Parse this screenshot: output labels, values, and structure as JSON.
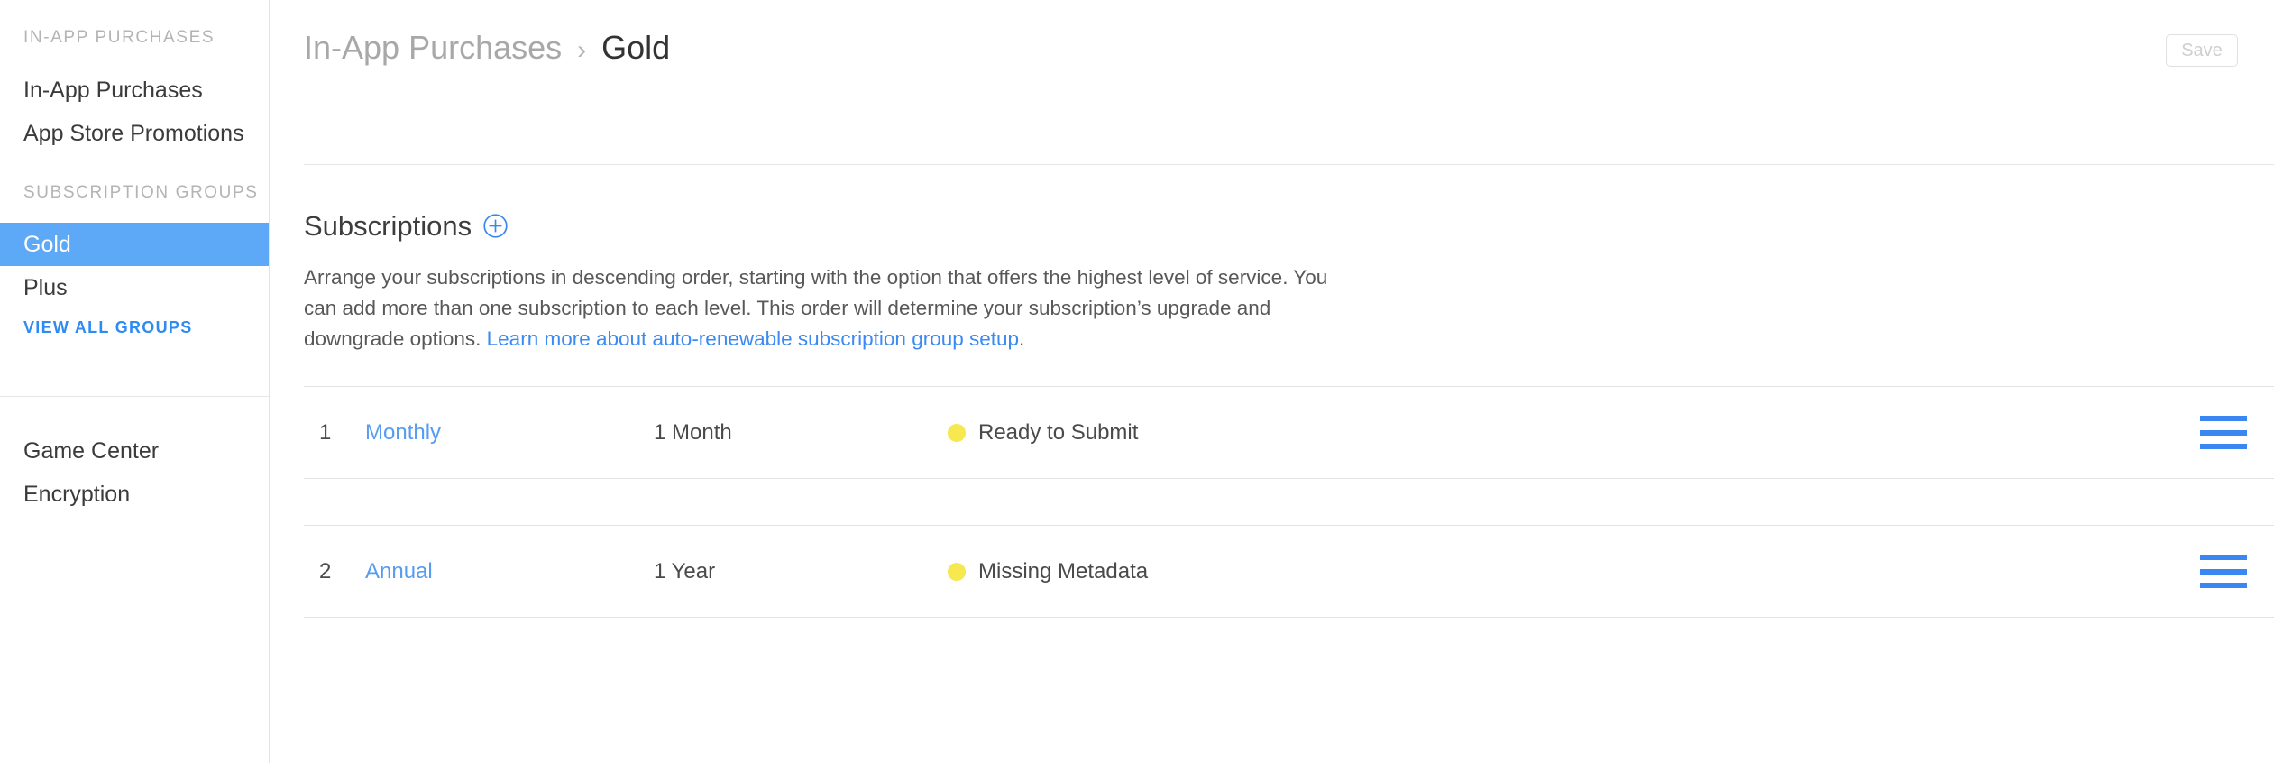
{
  "sidebar": {
    "sections": [
      {
        "header": "IN-APP PURCHASES",
        "items": [
          {
            "label": "In-App Purchases",
            "selected": false
          },
          {
            "label": "App Store Promotions",
            "selected": false
          }
        ]
      },
      {
        "header": "SUBSCRIPTION GROUPS",
        "items": [
          {
            "label": "Gold",
            "selected": true
          },
          {
            "label": "Plus",
            "selected": false
          }
        ],
        "link": "VIEW ALL GROUPS"
      },
      {
        "header": "",
        "items": [
          {
            "label": "Game Center",
            "selected": false
          },
          {
            "label": "Encryption",
            "selected": false
          }
        ]
      }
    ]
  },
  "header": {
    "breadcrumb_parent": "In-App Purchases",
    "breadcrumb_separator": "›",
    "breadcrumb_current": "Gold",
    "save_label": "Save",
    "save_disabled": true
  },
  "main": {
    "section_title": "Subscriptions",
    "add_icon": "plus-circle-icon",
    "description": {
      "part1": "Arrange your subscriptions in descending order, starting with the option that offers the highest level of service. You can add more than one subscription to each level. This order will determine your subscription’s upgrade and downgrade options. ",
      "link": "Learn more about auto-renewable subscription group setup",
      "part2": "."
    },
    "table": {
      "rows": [
        {
          "index": "1",
          "name": "Monthly",
          "duration": "1 Month",
          "status": "Ready to Submit",
          "status_color": "#f6e84e",
          "handle": "drag-handle-icon"
        },
        {
          "index": "2",
          "name": "Annual",
          "duration": "1 Year",
          "status": "Missing Metadata",
          "status_color": "#f6e84e",
          "handle": "drag-handle-icon"
        }
      ]
    }
  },
  "colors": {
    "accent_blue": "#3a87f2",
    "selected_row": "#5da8f7",
    "link_blue": "#3b8af2",
    "status_yellow": "#f6e84e"
  }
}
